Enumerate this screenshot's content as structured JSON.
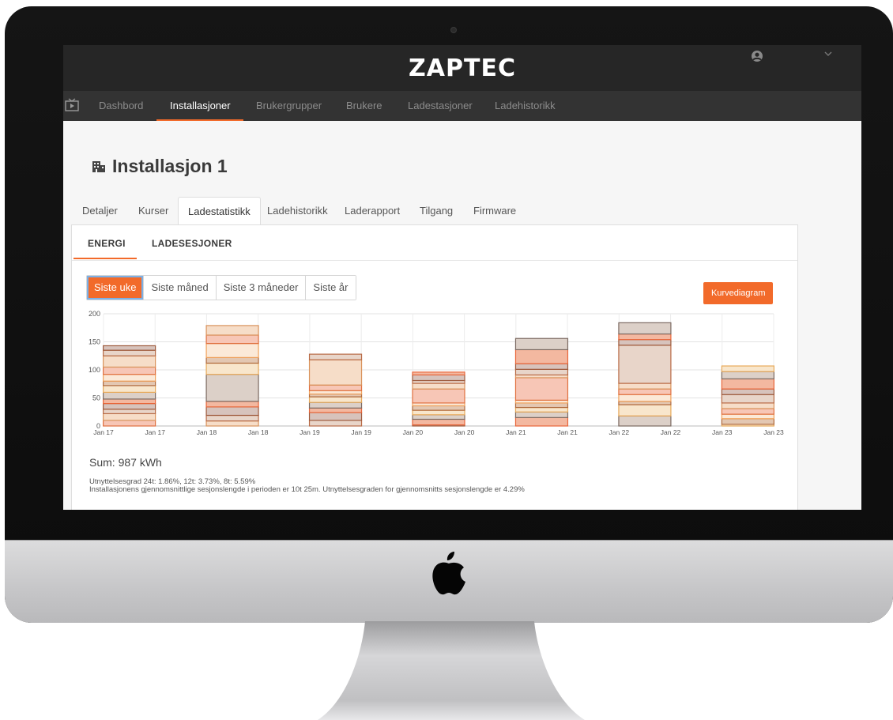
{
  "header": {
    "logo": "ZAPTEC"
  },
  "nav": {
    "items": [
      {
        "label": "Dashbord"
      },
      {
        "label": "Installasjoner",
        "active": true
      },
      {
        "label": "Brukergrupper"
      },
      {
        "label": "Brukere"
      },
      {
        "label": "Ladestasjoner"
      },
      {
        "label": "Ladehistorikk"
      }
    ]
  },
  "page": {
    "title": "Installasjon 1"
  },
  "tabs": [
    {
      "label": "Detaljer"
    },
    {
      "label": "Kurser"
    },
    {
      "label": "Ladestatistikk",
      "active": true
    },
    {
      "label": "Ladehistorikk"
    },
    {
      "label": "Laderapport"
    },
    {
      "label": "Tilgang"
    },
    {
      "label": "Firmware"
    }
  ],
  "subtabs": [
    {
      "label": "ENERGI",
      "active": true
    },
    {
      "label": "LADESESJONER"
    }
  ],
  "ranges": [
    {
      "label": "Siste uke",
      "active": true
    },
    {
      "label": "Siste måned"
    },
    {
      "label": "Siste 3 måneder"
    },
    {
      "label": "Siste år"
    }
  ],
  "chart_type_button": "Kurvediagram",
  "summary": {
    "sum": "Sum: 987 kWh",
    "util_line1": "Utnyttelsesgrad 24t: 1.86%, 12t: 3.73%, 8t: 5.59%",
    "util_line2": "Installasjonens gjennomsnittlige sesjonslengde i perioden er 10t 25m. Utnyttelsesgraden for gjennomsnitts sesjonslengde er 4.29%"
  },
  "colors": {
    "accent": "#f26a2a",
    "topbar": "#262626",
    "navbar": "#333333"
  },
  "chart_data": {
    "type": "bar",
    "stacked": true,
    "ylim": [
      0,
      200
    ],
    "yticks": [
      0,
      50,
      100,
      150,
      200
    ],
    "xticks": [
      "Jan 17",
      "Jan 17",
      "Jan 18",
      "Jan 18",
      "Jan 19",
      "Jan 19",
      "Jan 20",
      "Jan 20",
      "Jan 21",
      "Jan 21",
      "Jan 22",
      "Jan 22",
      "Jan 23",
      "Jan 23"
    ],
    "grid": true,
    "categories": [
      "Jan 17",
      "Jan 18",
      "Jan 19",
      "Jan 20",
      "Jan 21",
      "Jan 22",
      "Jan 23"
    ],
    "stacks": [
      [
        10,
        12,
        8,
        10,
        8,
        12,
        12,
        8,
        12,
        13,
        20,
        10,
        8
      ],
      [
        9,
        10,
        15,
        10,
        48,
        20,
        10,
        25,
        15,
        17
      ],
      [
        10,
        14,
        8,
        10,
        10,
        5,
        6,
        10,
        45,
        10
      ],
      [
        2,
        10,
        8,
        8,
        8,
        5,
        25,
        10,
        5,
        10,
        5
      ],
      [
        15,
        10,
        8,
        8,
        5,
        40,
        5,
        10,
        10,
        25,
        20
      ],
      [
        18,
        20,
        6,
        12,
        10,
        10,
        68,
        10,
        10,
        20
      ],
      [
        3,
        10,
        8,
        10,
        10,
        15,
        10,
        18,
        13,
        10
      ]
    ]
  }
}
